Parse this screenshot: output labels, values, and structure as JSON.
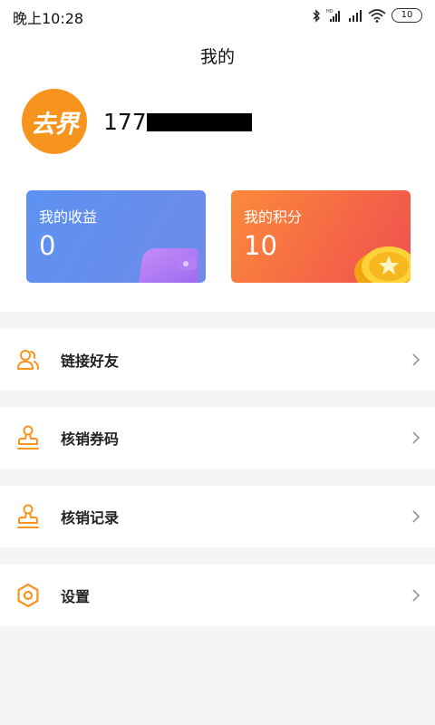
{
  "status_bar": {
    "time": "晚上10:28",
    "battery": "10",
    "icons": [
      "bluetooth-icon",
      "hd-signal-icon",
      "signal-icon",
      "wifi-icon",
      "battery-icon"
    ]
  },
  "header": {
    "title": "我的"
  },
  "profile": {
    "avatar_text": "去界",
    "phone_prefix": "177"
  },
  "cards": {
    "earnings": {
      "label": "我的收益",
      "value": "0"
    },
    "points": {
      "label": "我的积分",
      "value": "10"
    }
  },
  "menu": [
    {
      "label": "链接好友",
      "icon": "friends-icon"
    },
    {
      "label": "核销券码",
      "icon": "stamp-icon"
    },
    {
      "label": "核销记录",
      "icon": "stamp-icon"
    },
    {
      "label": "设置",
      "icon": "hexagon-settings-icon"
    }
  ],
  "colors": {
    "accent": "#f7941d",
    "card_blue": "#6a8fec",
    "card_orange": "#f66a44",
    "background": "#f4f5f7"
  }
}
